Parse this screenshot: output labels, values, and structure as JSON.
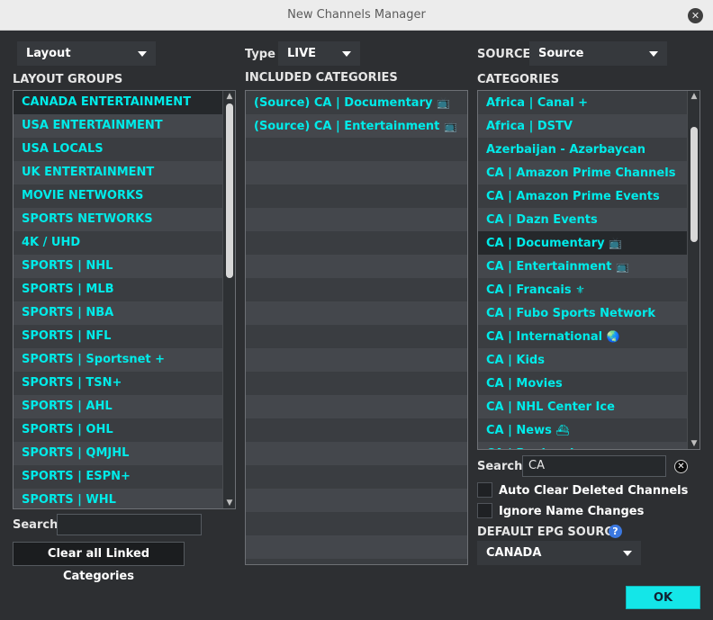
{
  "window": {
    "title": "New Channels Manager"
  },
  "layout": {
    "selected": "Layout"
  },
  "type": {
    "label": "Type",
    "selected": "LIVE"
  },
  "source": {
    "label": "SOURCE",
    "selected": "Source"
  },
  "layout_groups": {
    "label": "LAYOUT GROUPS",
    "items": [
      "CANADA ENTERTAINMENT",
      "USA ENTERTAINMENT",
      "USA LOCALS",
      "UK ENTERTAINMENT",
      "MOVIE NETWORKS",
      "SPORTS NETWORKS",
      "4K / UHD",
      "SPORTS | NHL",
      "SPORTS | MLB",
      "SPORTS | NBA",
      "SPORTS | NFL",
      "SPORTS | Sportsnet +",
      "SPORTS | TSN+",
      "SPORTS | AHL",
      "SPORTS | OHL",
      "SPORTS | QMJHL",
      "SPORTS | ESPN+",
      "SPORTS | WHL"
    ],
    "search_label": "Search",
    "search_value": "",
    "clear_button": "Clear all Linked Categories"
  },
  "included_categories": {
    "label": "INCLUDED CATEGORIES",
    "items": [
      {
        "text": "(Source) CA | Documentary",
        "icon": "📺"
      },
      {
        "text": "(Source) CA | Entertainment",
        "icon": "📺"
      }
    ]
  },
  "categories": {
    "label": "CATEGORIES",
    "items": [
      {
        "text": "Africa | Canal +",
        "icon": ""
      },
      {
        "text": "Africa | DSTV",
        "icon": ""
      },
      {
        "text": "Azerbaijan - Azərbaycan",
        "icon": ""
      },
      {
        "text": "CA | Amazon Prime Channels",
        "icon": ""
      },
      {
        "text": "CA | Amazon Prime Events",
        "icon": ""
      },
      {
        "text": "CA | Dazn Events",
        "icon": ""
      },
      {
        "text": "CA | Documentary",
        "icon": "📺"
      },
      {
        "text": "CA | Entertainment",
        "icon": "📺"
      },
      {
        "text": "CA | Francais",
        "icon": "⚜"
      },
      {
        "text": "CA | Fubo Sports Network",
        "icon": ""
      },
      {
        "text": "CA | International",
        "icon": "🌏"
      },
      {
        "text": "CA | Kids",
        "icon": ""
      },
      {
        "text": "CA | Movies",
        "icon": ""
      },
      {
        "text": "CA | NHL Center Ice",
        "icon": ""
      },
      {
        "text": "CA | News",
        "icon": "⛴"
      },
      {
        "text": "CA | Regional",
        "icon": ""
      }
    ],
    "search_label": "Search",
    "search_value": "CA"
  },
  "options": {
    "auto_clear": "Auto Clear Deleted Channels",
    "ignore_names": "Ignore Name Changes"
  },
  "epg": {
    "label": "DEFAULT EPG SOURCE",
    "selected": "CANADA"
  },
  "ok_button": "OK",
  "colors": {
    "accent": "#00ebe9",
    "ok": "#14e6e8",
    "background": "#2d2f32"
  }
}
